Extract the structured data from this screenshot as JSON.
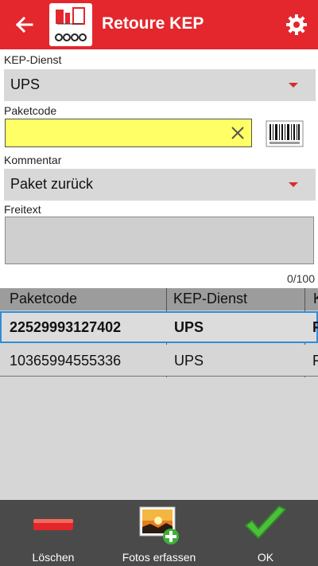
{
  "header": {
    "title": "Retoure KEP",
    "accent": "#e3272d"
  },
  "form": {
    "kep_label": "KEP-Dienst",
    "kep_value": "UPS",
    "paketcode_label": "Paketcode",
    "paketcode_value": "",
    "kommentar_label": "Kommentar",
    "kommentar_value": "Paket zurück",
    "freitext_label": "Freitext",
    "freitext_value": "",
    "counter": "0/100"
  },
  "table": {
    "headers": [
      "Paketcode",
      "KEP-Dienst",
      "K"
    ],
    "rows": [
      [
        "22529993127402",
        "UPS",
        "F"
      ],
      [
        "10365994555336",
        "UPS",
        "F"
      ]
    ]
  },
  "bottom": {
    "delete_label": "Löschen",
    "photos_label": "Fotos erfassen",
    "ok_label": "OK"
  }
}
